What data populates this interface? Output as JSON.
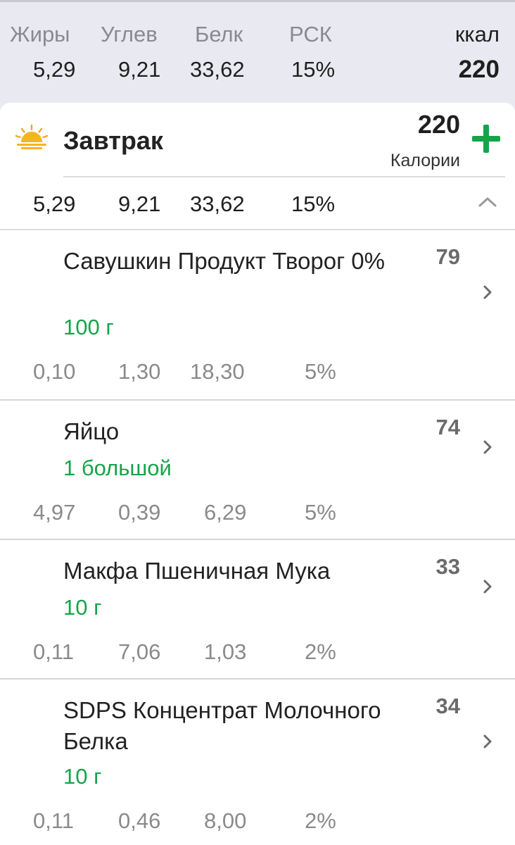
{
  "summary": {
    "labels": [
      "Жиры",
      "Углев",
      "Белк",
      "РСК"
    ],
    "values": [
      "5,29",
      "9,21",
      "33,62",
      "15%"
    ],
    "kcal_label": "ккал",
    "kcal_value": "220"
  },
  "meal": {
    "title": "Завтрак",
    "calories": "220",
    "calories_label": "Калории",
    "macros": [
      "5,29",
      "9,21",
      "33,62",
      "15%"
    ],
    "icon": "sunrise-icon"
  },
  "foods": [
    {
      "name": "Савушкин Продукт Творог 0%",
      "calories": "79",
      "portion": "100 г",
      "macros": [
        "0,10",
        "1,30",
        "18,30",
        "5%"
      ]
    },
    {
      "name": "Яйцо",
      "calories": "74",
      "portion": "1 большой",
      "macros": [
        "4,97",
        "0,39",
        "6,29",
        "5%"
      ]
    },
    {
      "name": "Макфа Пшеничная Мука",
      "calories": "33",
      "portion": "10 г",
      "macros": [
        "0,11",
        "7,06",
        "1,03",
        "2%"
      ]
    },
    {
      "name": "SDPS Концентрат Молочного Белка",
      "calories": "34",
      "portion": "10 г",
      "macros": [
        "0,11",
        "0,46",
        "8,00",
        "2%"
      ]
    }
  ],
  "colors": {
    "accent": "#17a34a",
    "background": "#e9eaf1",
    "muted": "#8a8a8e"
  }
}
